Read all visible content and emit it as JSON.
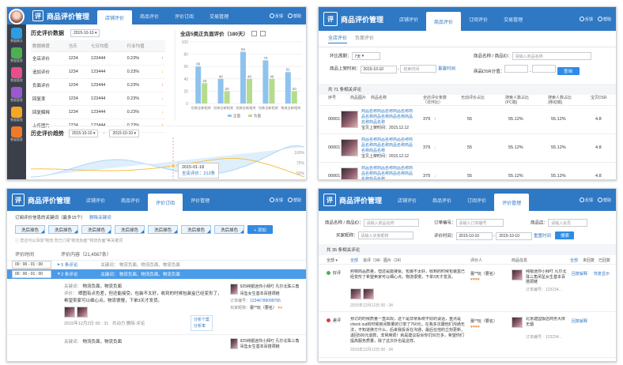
{
  "app_title": "商品评价管理",
  "logo_glyph": "评",
  "header_links": {
    "feedback": "反馈",
    "help": "帮助"
  },
  "p1": {
    "tabs": [
      "店铺评价",
      "商品评价",
      "评价订阅",
      "交易管理"
    ],
    "active_tab": 0,
    "sidebar": [
      "数据概况",
      "数据管理",
      "数据管理",
      "数据管理",
      "数据管理",
      "数据管理"
    ],
    "hist": {
      "title": "历史评价数据",
      "date": "2015-10-10",
      "headers": [
        "数据维度",
        "当天",
        "七日均值",
        "行业均值"
      ],
      "rows": [
        {
          "dim": "全店评价",
          "day": "1234",
          "week": "123444",
          "pct": "0.23%",
          "dir": "up"
        },
        {
          "dim": "追加评价",
          "day": "1234",
          "week": "123444",
          "pct": "0.23%",
          "dir": "down"
        },
        {
          "dim": "负面评价",
          "day": "1234",
          "week": "123444",
          "pct": "0.23%",
          "dir": "up"
        },
        {
          "dim": "回复率",
          "day": "1234",
          "week": "123444",
          "pct": "0.23%",
          "dir": "down"
        },
        {
          "dim": "回复解释",
          "day": "1234",
          "week": "123444",
          "pct": "0.23%",
          "dir": "down"
        },
        {
          "dim": "上传图片",
          "day": "1234",
          "week": "123444",
          "pct": "0.23%",
          "dir": "up"
        }
      ]
    },
    "neg_chart": {
      "title": "全店5类正负面评价（180天）",
      "categories": [
        "包装全新相关",
        "包装全新相关",
        "包装全新相关",
        "包装全新相关",
        "物流全新相关"
      ],
      "legend": [
        "正面",
        "负面"
      ],
      "yticks": [
        "100",
        "80",
        "60",
        "40",
        "20",
        "0"
      ]
    },
    "trend": {
      "title": "历史评价趋势",
      "from": "2015-10-10",
      "to": "2015-10-10",
      "tooltip_date": "2015-01-18",
      "tooltip_value": "全店评价：212条",
      "yticks_right": [
        "100%",
        "75%",
        "50%"
      ]
    }
  },
  "chart_data": {
    "type": "bar",
    "title": "全店5类正负面评价（180天）",
    "categories": [
      "包装全新相关",
      "包装全新相关",
      "包装全新相关",
      "包装全新相关",
      "物流全新相关"
    ],
    "series": [
      {
        "name": "正面",
        "values": [
          60,
          40,
          84,
          70,
          51
        ]
      },
      {
        "name": "负面",
        "values": [
          33,
          20,
          40,
          40,
          20
        ]
      }
    ],
    "ylim": [
      0,
      100
    ],
    "value_labels": [
      [
        "60",
        "33"
      ],
      [
        "40",
        "20"
      ],
      [
        "84",
        "40"
      ],
      [
        "70",
        "40"
      ],
      [
        "51",
        "20"
      ]
    ]
  },
  "p2": {
    "tabs": [
      "店铺评价",
      "商品评价",
      "订阅评价",
      "交易管理"
    ],
    "active_tab": 1,
    "subtabs": [
      "全店评价",
      "负面评价"
    ],
    "filters": {
      "cycle_label": "环比周期：",
      "cycle_value": "7天",
      "name_label": "商品名称 / 商品ID：",
      "name_placeholder": "请输入商品名称",
      "date_label": "商品上架时间：",
      "date_from": "2015-10-10",
      "date_to": "结束时间",
      "reset": "重置时间",
      "dsr_label": "商品DSR分值：",
      "query": "查询"
    },
    "count_text": "共 71 条相关评论",
    "headers": [
      "序号",
      "商品图片",
      "商品名称",
      "全店评价条数\n（日环比）",
      "无动评价占比",
      "搜索人数占比\n(PC端)",
      "搜索人数占比\n(移动端)",
      "宝贝DSR"
    ],
    "product_name": "商品名称商品名称商品名称商品名称商品名称商品名称商品名称商品名称",
    "listed": "宝贝上架时间：2015.12.12",
    "rows": [
      {
        "id": "00001",
        "count": "379",
        "dir": "up",
        "ratio": "55",
        "pc": "55.12%",
        "mobile": "55.12%",
        "dsr": "4.8"
      },
      {
        "id": "00001",
        "count": "379",
        "dir": "down",
        "ratio": "55",
        "pc": "55.12%",
        "mobile": "55.12%",
        "dsr": "4.8"
      },
      {
        "id": "00001",
        "count": "379",
        "dir": "down",
        "ratio": "55",
        "pc": "55.12%",
        "mobile": "55.12%",
        "dsr": "4.8"
      }
    ]
  },
  "p3": {
    "tabs": [
      "店铺评价",
      "商品评价",
      "评价订阅",
      "评价管理"
    ],
    "active_tab": 2,
    "keyword_title": "订阅评价信息的关键词（最多15个）",
    "clear_link": "删除关键词",
    "chips": [
      "洗后掉色",
      "洗后掉色",
      "洗后掉色",
      "洗后掉色",
      "洗后掉色",
      "洗后掉色",
      "洗后掉色"
    ],
    "add": "+ 添加",
    "hint": "您还可以添加“物流",
    "hint2": "您已订阅“物流负面”“物流负面”等关键词",
    "col_time": "评价时间",
    "col_content": "评价内容（21,4567条）",
    "row1_time": "00 : 00 - 01 : 00",
    "row1_text": "5 条评论",
    "row1_tags": "关键词：  物流负面、物流负面、物流负面",
    "row2_time": "00 : 00 - 01 : 00",
    "row2_text": "2 条评论",
    "row2_tags": "关键词：  物流负面、物流负面、物流负面",
    "detail_kw_label": "关键词：",
    "detail_kw": "物流负面，物流负面",
    "detail_label": "评价：",
    "detail_text": "晒图有点色差，但还能接受。包装不太好，收到的时候包装盒已经变形了，希望卖家可以细心点。物流很慢，下单3天才发货。",
    "detail_date": "2015年12月2日  00 : 31",
    "detail_meta": "共动力  删除  评论",
    "popup": [
      "分析个案",
      "分析率"
    ],
    "order_label": "订单编号：",
    "order_no": "12346789098765",
    "buyer_label": "买家昵称：",
    "buyer": "蕾**玩（要名）",
    "shop_name": "925纯银迷你小拜叮 凡尔北珠三角吊坠女生基本百搭颈链",
    "detail2_kw": "物流负面，物流负面"
  },
  "p4": {
    "tabs": [
      "店铺评价",
      "商品评价",
      "订阅评价",
      "评价管理"
    ],
    "active_tab": 3,
    "f_name_label": "商品名称 / 商品ID：",
    "f_name_ph": "请输入商品名称",
    "f_order_label": "订单编号：",
    "f_order_ph": "请输入订单编号",
    "f_shop_label": "商品店：",
    "f_shop_ph": "请输入会员",
    "f_buyer_label": "买家昵称：",
    "f_buyer_ph": "请输入买家昵称",
    "f_date_label": "评价时间：",
    "f_date_from": "2015-10-10",
    "f_date_to": "2015-10-10",
    "f_reset": "重置时间",
    "f_search": "搜索",
    "count_text": "共 35 条相关评论",
    "headers": [
      "全部",
      "全部",
      "追评（34）",
      "图片（24）",
      "评价人",
      "商品信息",
      "全部",
      "未回复",
      "已回复"
    ],
    "rows": [
      {
        "tag": "好评",
        "text": "购物商品质量，但还是能接受。包装不太好，收到的时候包装盒已经变形了希望卖家可以细心点。物流很慢，下单3天才发货。",
        "date": "2015年12月12日  00 : 34",
        "buyer": "蕾**玩（要名）",
        "shop": "纯银迷你小拜叮 凡尔北珠三角吊坠女生基本百搭颈链",
        "order": "订单编号：123234...",
        "action": "回复解释",
        "action2": "恢复显示"
      },
      {
        "tag": "差评",
        "text": "预订的时候质量一直出现，这个是非常系统不好的谈话，重点是check out的时候房间数量的订单了760元，在我多次跟他们沟通无法，不知道换方什么，后来我投诉在沟通，最后在他的立刻更新，退回500元退款，非常麻烦！就是建议投诉你们50万多，希望你们提高服务质量，除了这次外也是这样。",
        "date": "2015年12月12日  00 : 34",
        "buyer": "蕾**玩（要名）",
        "shop": "北京建国饭店商务大床无烟",
        "order": "订单编号：123234...",
        "action": "回复解释"
      }
    ]
  },
  "colors": {
    "accent": "#2f78c4",
    "bar_pos": "#8fc3ee",
    "bar_neg": "#b5dc8c",
    "up": "#e23b3b",
    "down": "#e8a530"
  }
}
